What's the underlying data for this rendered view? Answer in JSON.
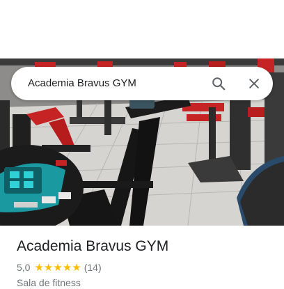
{
  "search": {
    "query": "Academia Bravus GYM"
  },
  "icons": {
    "search": "search-icon",
    "close": "close-icon",
    "star": "star-icon"
  },
  "place": {
    "name": "Academia Bravus GYM",
    "rating": "5,0",
    "stars": 5,
    "review_count": "(14)",
    "category": "Sala de fitness"
  },
  "colors": {
    "star": "#fbbc04",
    "text_primary": "#202124",
    "text_secondary": "#70757a",
    "gym_red": "#cc1f1f"
  }
}
